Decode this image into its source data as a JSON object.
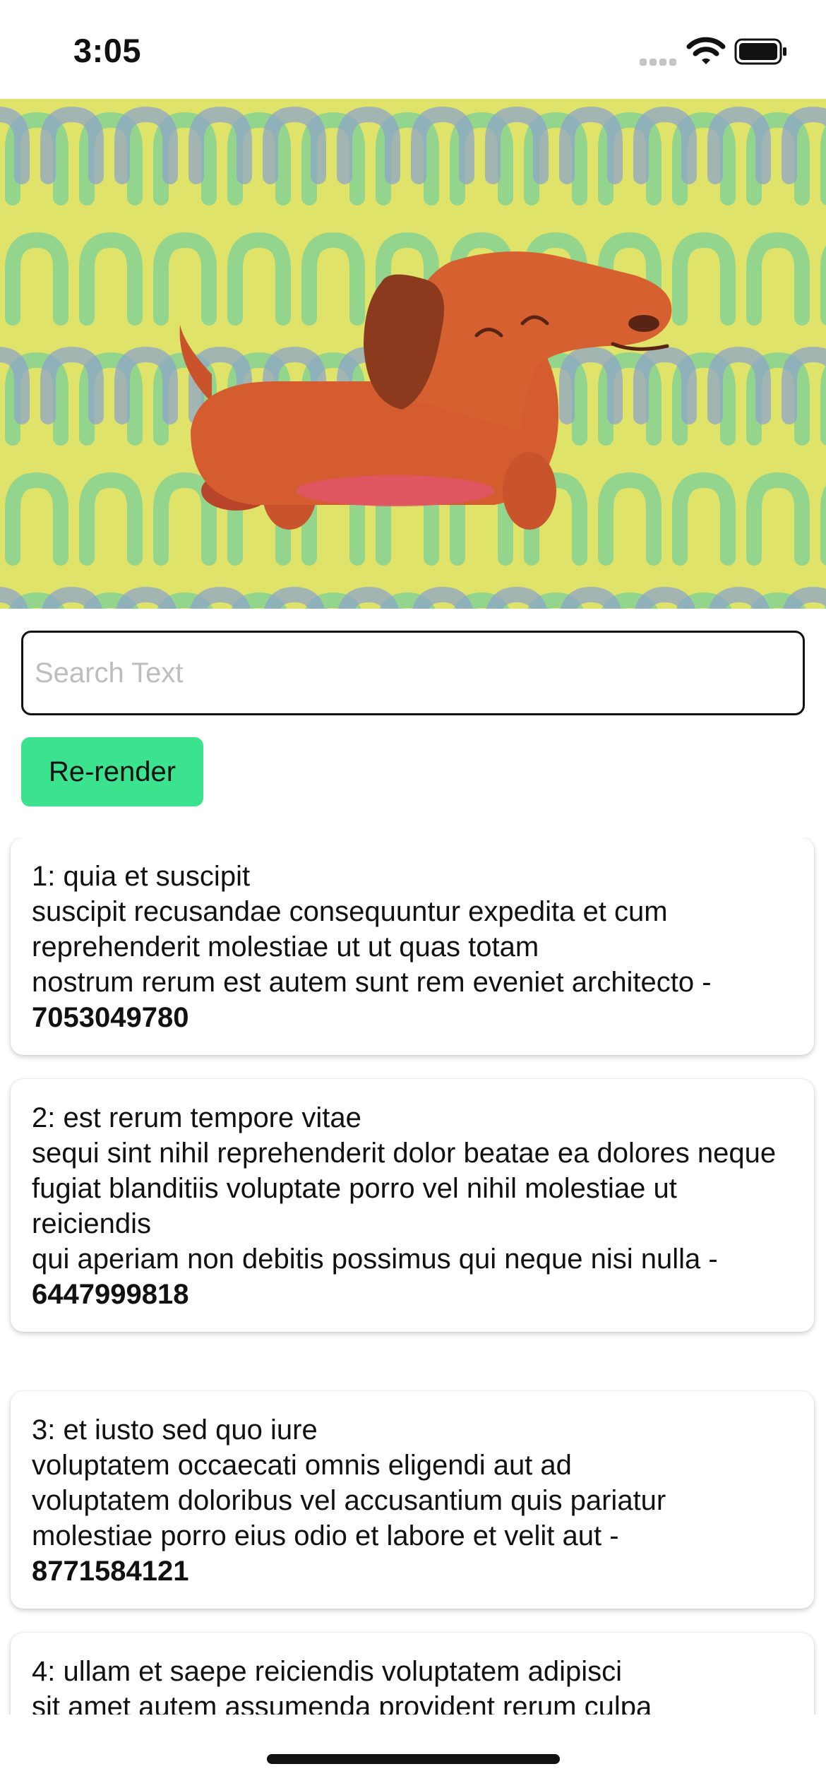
{
  "status_bar": {
    "time": "3:05"
  },
  "search": {
    "placeholder": "Search Text",
    "value": ""
  },
  "rerender_label": "Re-render",
  "items": [
    {
      "title": "1: quia et suscipit",
      "body": [
        "suscipit recusandae consequuntur expedita et cum",
        "reprehenderit molestiae ut ut quas totam",
        "nostrum rerum est autem sunt rem eveniet architecto -"
      ],
      "number": "7053049780"
    },
    {
      "title": "2: est rerum tempore vitae",
      "body": [
        "sequi sint nihil reprehenderit dolor beatae ea dolores neque",
        "fugiat blanditiis voluptate porro vel nihil molestiae ut reiciendis",
        "qui aperiam non debitis possimus qui neque nisi nulla -"
      ],
      "number": "6447999818"
    },
    {
      "title": "3: et iusto sed quo iure",
      "body": [
        "voluptatem occaecati omnis eligendi aut ad",
        "voluptatem doloribus vel accusantium quis pariatur",
        "molestiae porro eius odio et labore et velit aut -"
      ],
      "number": "8771584121"
    },
    {
      "title": "4: ullam et saepe reiciendis voluptatem adipisci",
      "body": [
        "sit amet autem assumenda provident rerum culpa"
      ],
      "number": ""
    }
  ],
  "colors": {
    "accent_button": "#3be38f",
    "hero_background": "#dfe36a",
    "dog": "#cf5a2c"
  },
  "icons": [
    "signal-icon",
    "wifi-icon",
    "battery-icon",
    "dachshund-illustration"
  ]
}
